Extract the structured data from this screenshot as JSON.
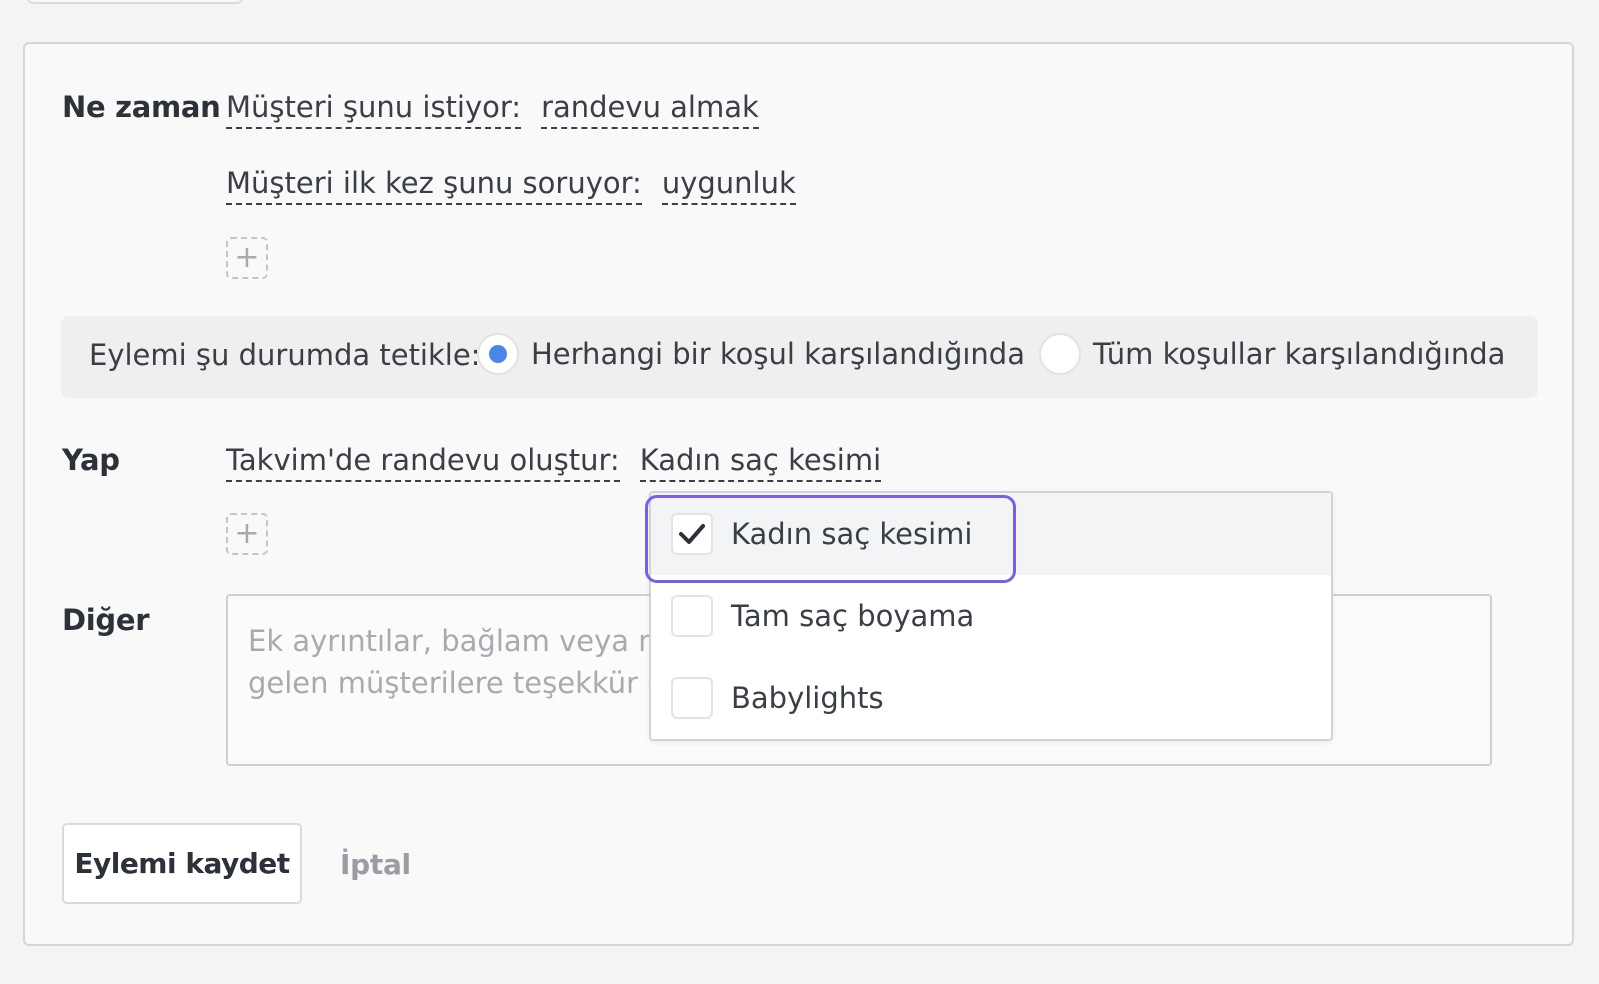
{
  "when": {
    "label": "Ne zaman",
    "conditions": [
      {
        "field": "Müşteri şunu istiyor:",
        "value": "randevu almak"
      },
      {
        "field": "Müşteri ilk kez şunu soruyor:",
        "value": "uygunluk"
      }
    ],
    "add_symbol": "+"
  },
  "trigger": {
    "label": "Eylemi şu durumda tetikle:",
    "options": [
      {
        "label": "Herhangi bir koşul karşılandığında",
        "selected": true
      },
      {
        "label": "Tüm koşullar karşılandığında",
        "selected": false
      }
    ]
  },
  "do": {
    "label": "Yap",
    "action": {
      "field": "Takvim'de randevu oluştur:",
      "value": "Kadın saç kesimi"
    },
    "add_symbol": "+",
    "dropdown_items": [
      {
        "label": "Kadın saç kesimi",
        "checked": true
      },
      {
        "label": "Tam saç boyama",
        "checked": false
      },
      {
        "label": "Babylights",
        "checked": false
      }
    ]
  },
  "other": {
    "label": "Diğer",
    "placeholder_line1": "Ek ayrıntılar, bağlam veya notlar",
    "placeholder_line2": "gelen müşterilere teşekkür edin"
  },
  "footer": {
    "save_label": "Eylemi kaydet",
    "cancel_label": "İptal"
  },
  "colors": {
    "accent_radio": "#4a86e8",
    "focus_ring": "#7b5de8"
  }
}
